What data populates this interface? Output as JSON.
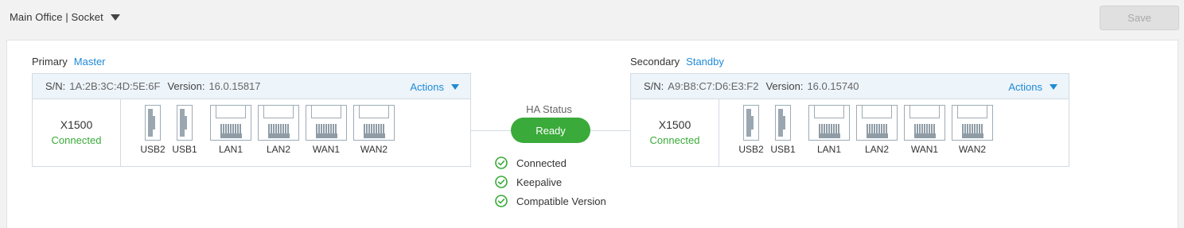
{
  "header": {
    "site_title": "Main Office | Socket",
    "save_label": "Save"
  },
  "primary": {
    "role_label": "Primary",
    "role_value": "Master",
    "sn_label": "S/N:",
    "sn": "1A:2B:3C:4D:5E:6F",
    "version_label": "Version:",
    "version": "16.0.15817",
    "actions_label": "Actions",
    "model": "X1500",
    "status": "Connected",
    "ports": [
      "USB2",
      "USB1",
      "LAN1",
      "LAN2",
      "WAN1",
      "WAN2"
    ]
  },
  "secondary": {
    "role_label": "Secondary",
    "role_value": "Standby",
    "sn_label": "S/N:",
    "sn": "A9:B8:C7:D6:E3:F2",
    "version_label": "Version:",
    "version": "16.0.15740",
    "actions_label": "Actions",
    "model": "X1500",
    "status": "Connected",
    "ports": [
      "USB2",
      "USB1",
      "LAN1",
      "LAN2",
      "WAN1",
      "WAN2"
    ]
  },
  "ha": {
    "title": "HA Status",
    "state": "Ready",
    "checks": [
      "Connected",
      "Keepalive",
      "Compatible Version"
    ]
  },
  "colors": {
    "accent": "#1f8ad6",
    "success": "#3aaa3a",
    "header_bg": "#edf4fa"
  }
}
